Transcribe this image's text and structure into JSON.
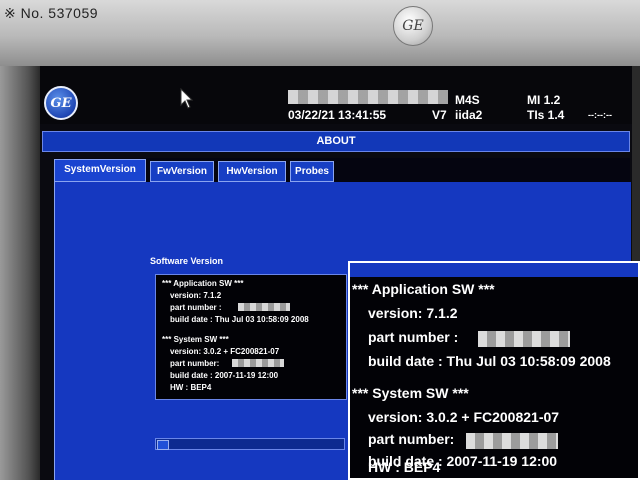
{
  "photo_note": "※ No. 537059",
  "header": {
    "date_time": "03/22/21 13:41:55",
    "probe": "M4S",
    "software": "V7",
    "user": "iida2",
    "mi": "MI 1.2",
    "tis": "TIs 1.4",
    "misc": "--:--:--"
  },
  "dialog_title": "ABOUT",
  "tabs": [
    {
      "label": "SystemVersion",
      "active": true
    },
    {
      "label": "FwVersion",
      "active": false
    },
    {
      "label": "HwVersion",
      "active": false
    },
    {
      "label": "Probes",
      "active": false
    }
  ],
  "software_version": {
    "heading": "Software Version",
    "app_header": "*** Application SW ***",
    "app_version": "version: 7.1.2",
    "app_part": "part number :",
    "app_build": "build date : Thu Jul 03 10:58:09 2008",
    "sys_header": "*** System SW ***",
    "sys_version": "version: 3.0.2 + FC200821-07",
    "sys_part": "part number:",
    "sys_build": "build date : 2007-11-19 12:00",
    "sys_hw": "HW : BEP4"
  },
  "colors": {
    "panel_blue": "#1538c0",
    "screen_black": "#0a0a10",
    "text": "#ffffff"
  },
  "icons": {
    "brand": "ge-logo-icon",
    "pointer": "mouse-cursor-icon"
  }
}
